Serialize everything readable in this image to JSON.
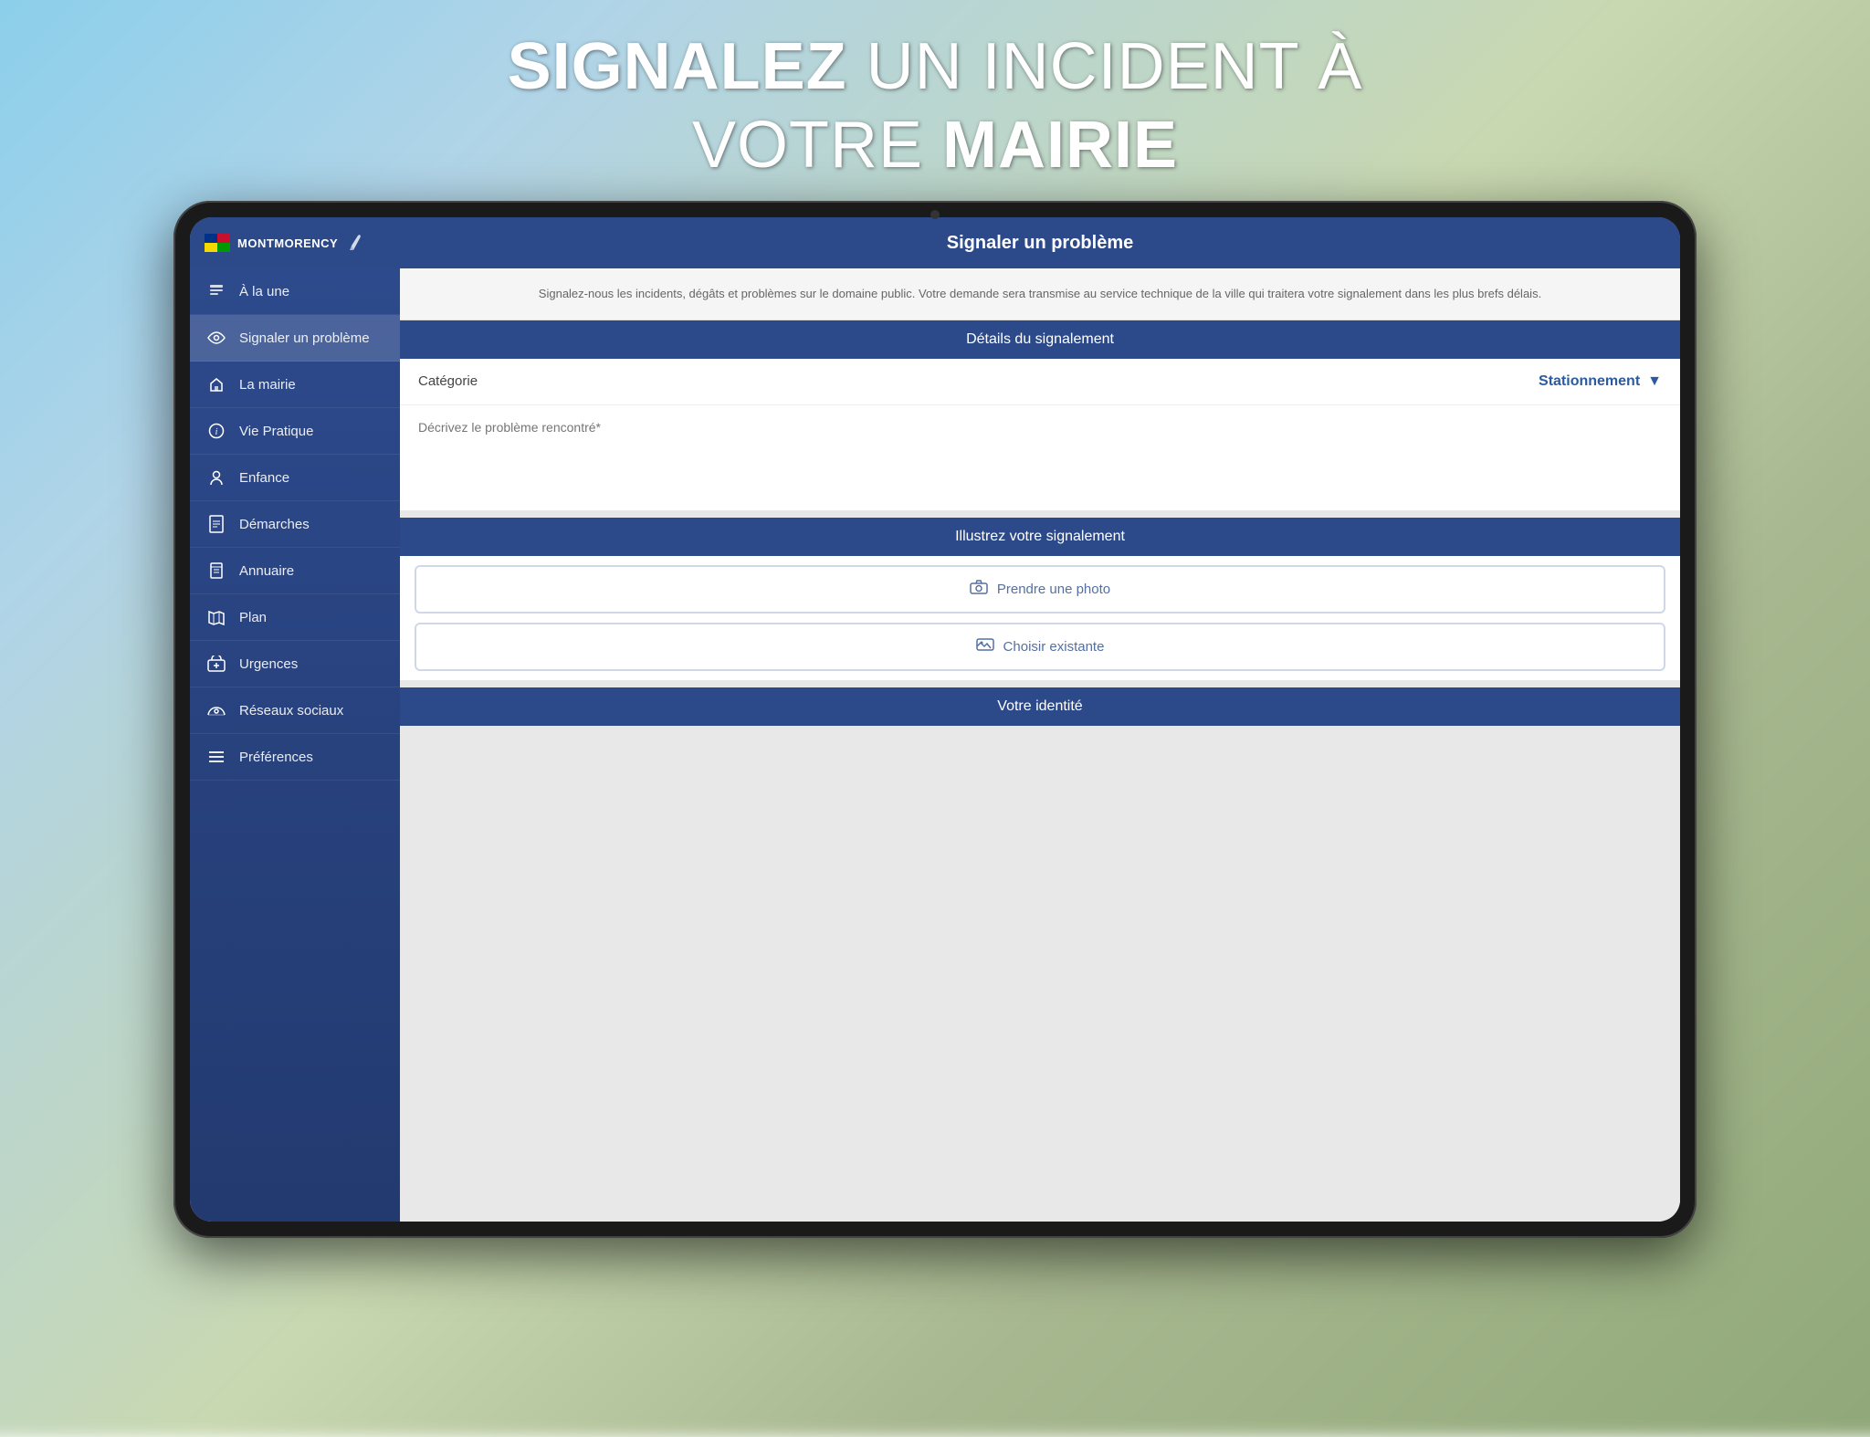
{
  "page": {
    "headline_part1": "SIGNALEZ",
    "headline_part2": " UN INCIDENT À",
    "headline_line2_part1": "VOTRE ",
    "headline_line2_part2": "MAIRIE"
  },
  "header": {
    "brand": "MONTMORENCY",
    "title": "Signaler un problème"
  },
  "sidebar": {
    "items": [
      {
        "id": "a-la-une",
        "label": "À la une",
        "icon": "🏛"
      },
      {
        "id": "signaler",
        "label": "Signaler un problème",
        "icon": "👁"
      },
      {
        "id": "mairie",
        "label": "La mairie",
        "icon": "🏛"
      },
      {
        "id": "vie-pratique",
        "label": "Vie Pratique",
        "icon": "ℹ"
      },
      {
        "id": "enfance",
        "label": "Enfance",
        "icon": "😊"
      },
      {
        "id": "demarches",
        "label": "Démarches",
        "icon": "📋"
      },
      {
        "id": "annuaire",
        "label": "Annuaire",
        "icon": "📖"
      },
      {
        "id": "plan",
        "label": "Plan",
        "icon": "📍"
      },
      {
        "id": "urgences",
        "label": "Urgences",
        "icon": "🚑"
      },
      {
        "id": "reseaux",
        "label": "Réseaux sociaux",
        "icon": "💬"
      },
      {
        "id": "preferences",
        "label": "Préférences",
        "icon": "≡"
      }
    ]
  },
  "intro": {
    "text": "Signalez-nous les incidents, dégâts et problèmes sur le domaine public. Votre demande sera transmise au service technique de la ville qui traitera votre signalement dans les plus brefs délais."
  },
  "form": {
    "details_section_title": "Détails du signalement",
    "category_label": "Catégorie",
    "category_value": "Stationnement",
    "description_placeholder": "Décrivez le problème rencontré*",
    "photo_section_title": "Illustrez votre signalement",
    "photo_btn1": "Prendre une photo",
    "photo_btn2": "Choisir existante",
    "identity_section_title": "Votre identité"
  },
  "colors": {
    "primary": "#2c4a8a",
    "sidebar_bg": "#2d4a8c",
    "button_border": "#d0d8e8",
    "text_primary": "#444",
    "text_blue": "#2c5aa0"
  }
}
